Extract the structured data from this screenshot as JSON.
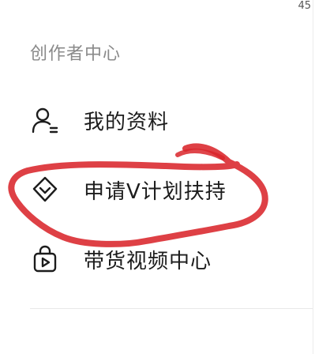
{
  "status": {
    "counter": "45"
  },
  "section": {
    "title": "创作者中心"
  },
  "menu": {
    "items": [
      {
        "label": "我的资料",
        "icon": "user-profile-icon"
      },
      {
        "label": "申请V计划扶持",
        "icon": "heart-badge-icon"
      },
      {
        "label": "带货视频中心",
        "icon": "shopping-bag-play-icon"
      }
    ]
  },
  "annotation": {
    "color": "#d9262b"
  }
}
